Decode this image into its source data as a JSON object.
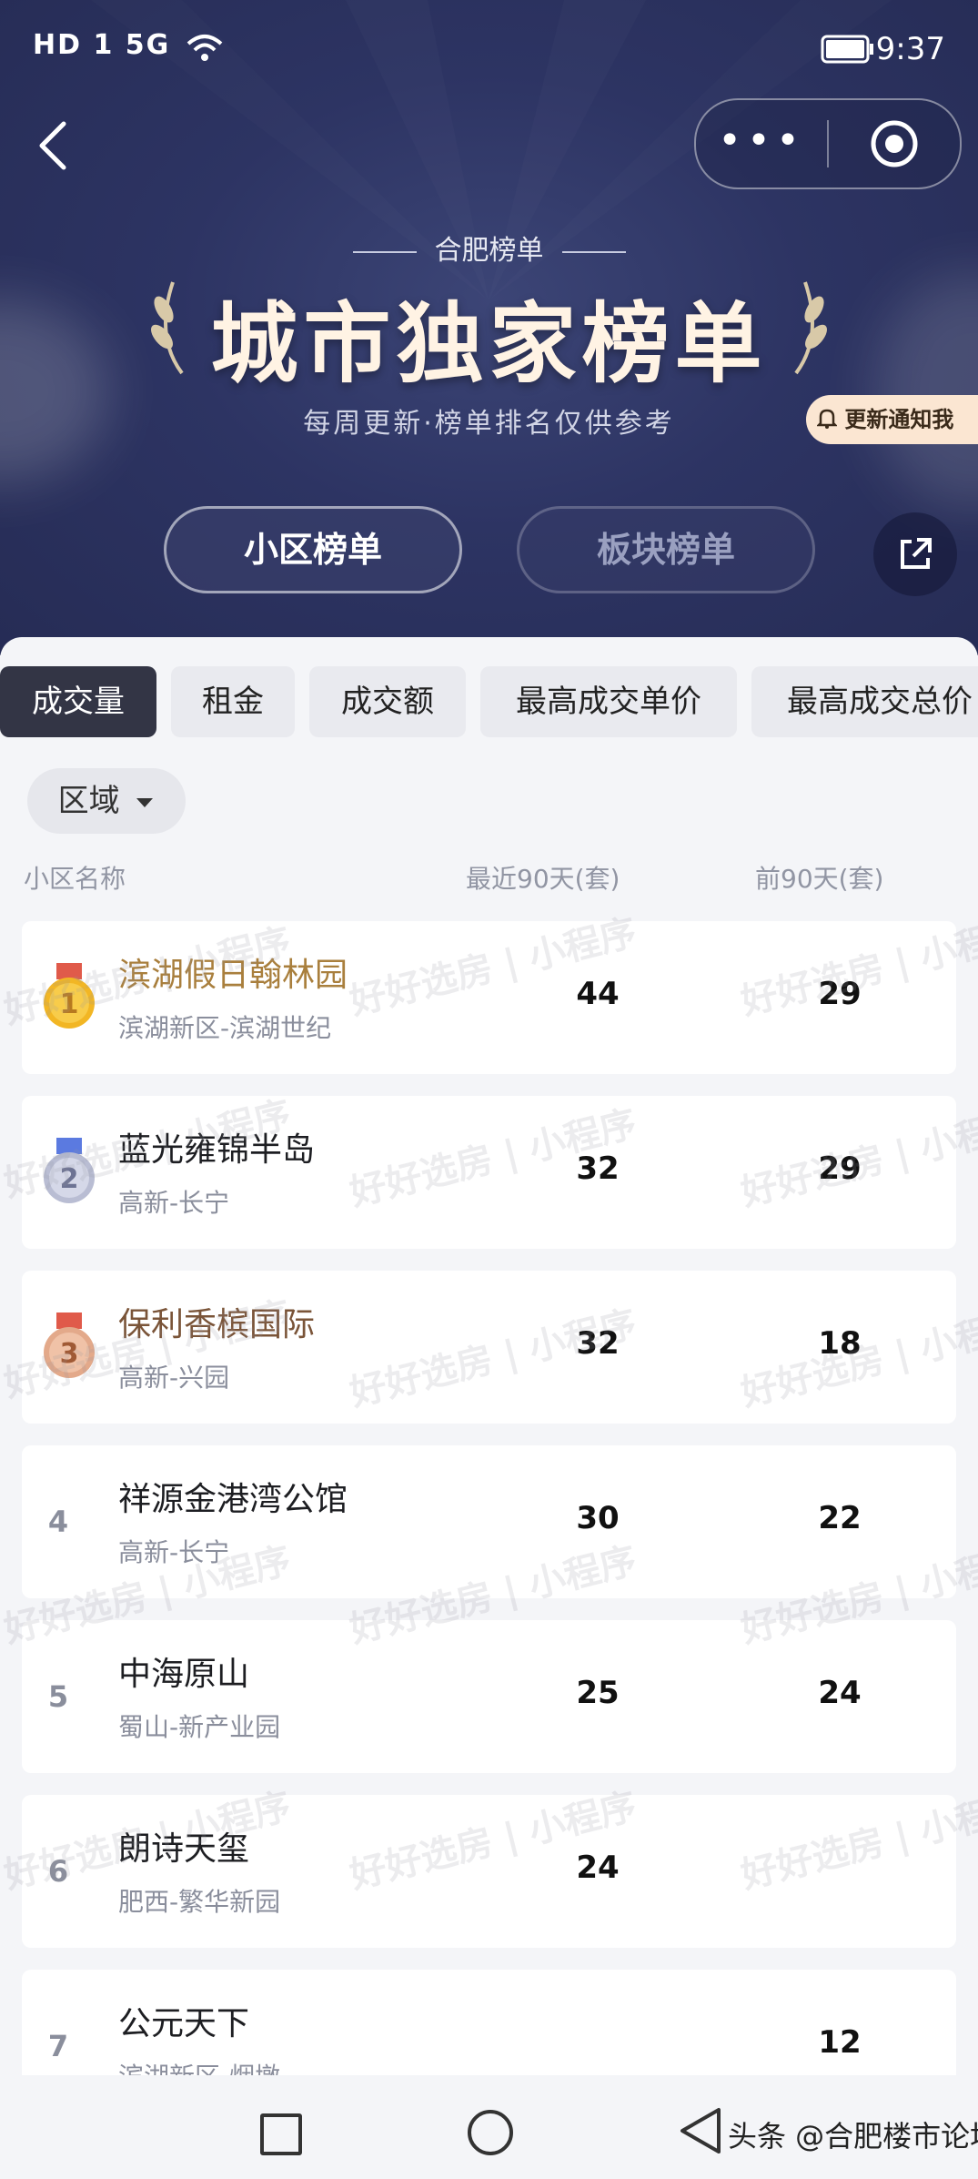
{
  "status_bar": {
    "left": "HD 1 5G",
    "time": "9:37"
  },
  "header": {
    "subtitle": "合肥榜单",
    "title": "城市独家榜单",
    "tagline": "每周更新·榜单排名仅供参考",
    "notify_label": "更新通知我",
    "segments": [
      "小区榜单",
      "板块榜单"
    ],
    "active_segment": "小区榜单"
  },
  "tabs": [
    "成交量",
    "租金",
    "成交额",
    "最高成交单价",
    "最高成交总价"
  ],
  "active_tab": "成交量",
  "filter": {
    "label": "区域"
  },
  "columns": {
    "name": "小区名称",
    "recent": "最近90天(套)",
    "prev": "前90天(套)"
  },
  "rows": [
    {
      "rank": "1",
      "name": "滨湖假日翰林园",
      "area": "滨湖新区-滨湖世纪",
      "recent": "44",
      "prev": "29"
    },
    {
      "rank": "2",
      "name": "蓝光雍锦半岛",
      "area": "高新-长宁",
      "recent": "32",
      "prev": "29"
    },
    {
      "rank": "3",
      "name": "保利香槟国际",
      "area": "高新-兴园",
      "recent": "32",
      "prev": "18"
    },
    {
      "rank": "4",
      "name": "祥源金港湾公馆",
      "area": "高新-长宁",
      "recent": "30",
      "prev": "22"
    },
    {
      "rank": "5",
      "name": "中海原山",
      "area": "蜀山-新产业园",
      "recent": "25",
      "prev": "24"
    },
    {
      "rank": "6",
      "name": "朗诗天玺",
      "area": "肥西-繁华新园",
      "recent": "24",
      "prev": ""
    },
    {
      "rank": "7",
      "name": "公元天下",
      "area": "滨湖新区-烟墩",
      "recent": "",
      "prev": "12"
    }
  ],
  "watermark": "好好选房 | 小程序",
  "credit": "头条 @合肥楼市论坛",
  "colors": {
    "gold": "#a97f3d",
    "bronze": "#7a5438",
    "active_tab": "#333545"
  }
}
